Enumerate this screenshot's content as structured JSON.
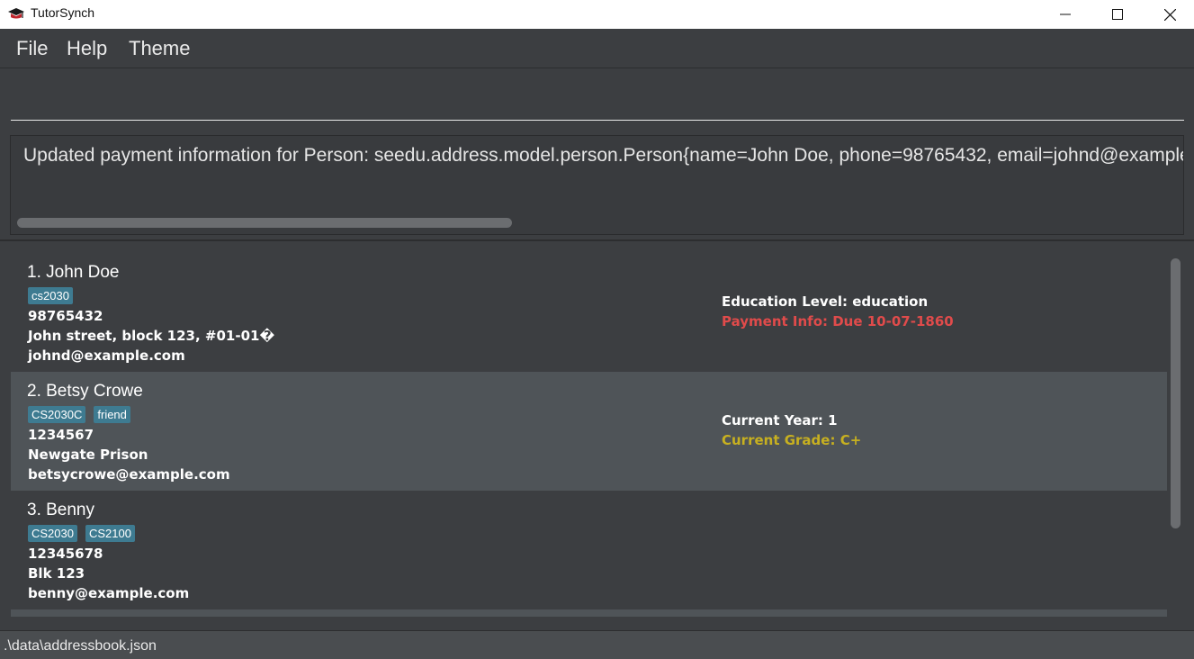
{
  "window": {
    "title": "TutorSynch",
    "minimize": "—",
    "maximize": "☐",
    "close": "✕"
  },
  "menu": [
    "File",
    "Help",
    "Theme"
  ],
  "command": {
    "value": "",
    "placeholder": ""
  },
  "result": {
    "text": "Updated payment information for Person: seedu.address.model.person.Person{name=John Doe, phone=98765432, email=johnd@example.com"
  },
  "persons": [
    {
      "name": "1. John Doe",
      "tags": [
        "cs2030"
      ],
      "phone": "98765432",
      "address": "John street, block 123, #01-01�",
      "email": "johnd@example.com",
      "info1": "Education Level: education",
      "info2": "Payment Info: Due 10-07-1860"
    },
    {
      "name": "2. Betsy Crowe",
      "tags": [
        "CS2030C",
        "friend"
      ],
      "phone": "1234567",
      "address": "Newgate Prison",
      "email": "betsycrowe@example.com",
      "info1": "Current Year: 1",
      "info2": "Current Grade: C+"
    },
    {
      "name": "3. Benny",
      "tags": [
        "CS2030",
        "CS2100"
      ],
      "phone": "12345678",
      "address": "Blk 123",
      "email": "benny@example.com",
      "info1": "",
      "info2": ""
    }
  ],
  "status": {
    "path": ".\\data\\addressbook.json"
  },
  "colors": {
    "background": "#3c3e41",
    "tag": "#3e7b91",
    "payment_due": "#e04b4b",
    "grade": "#c7b020"
  }
}
